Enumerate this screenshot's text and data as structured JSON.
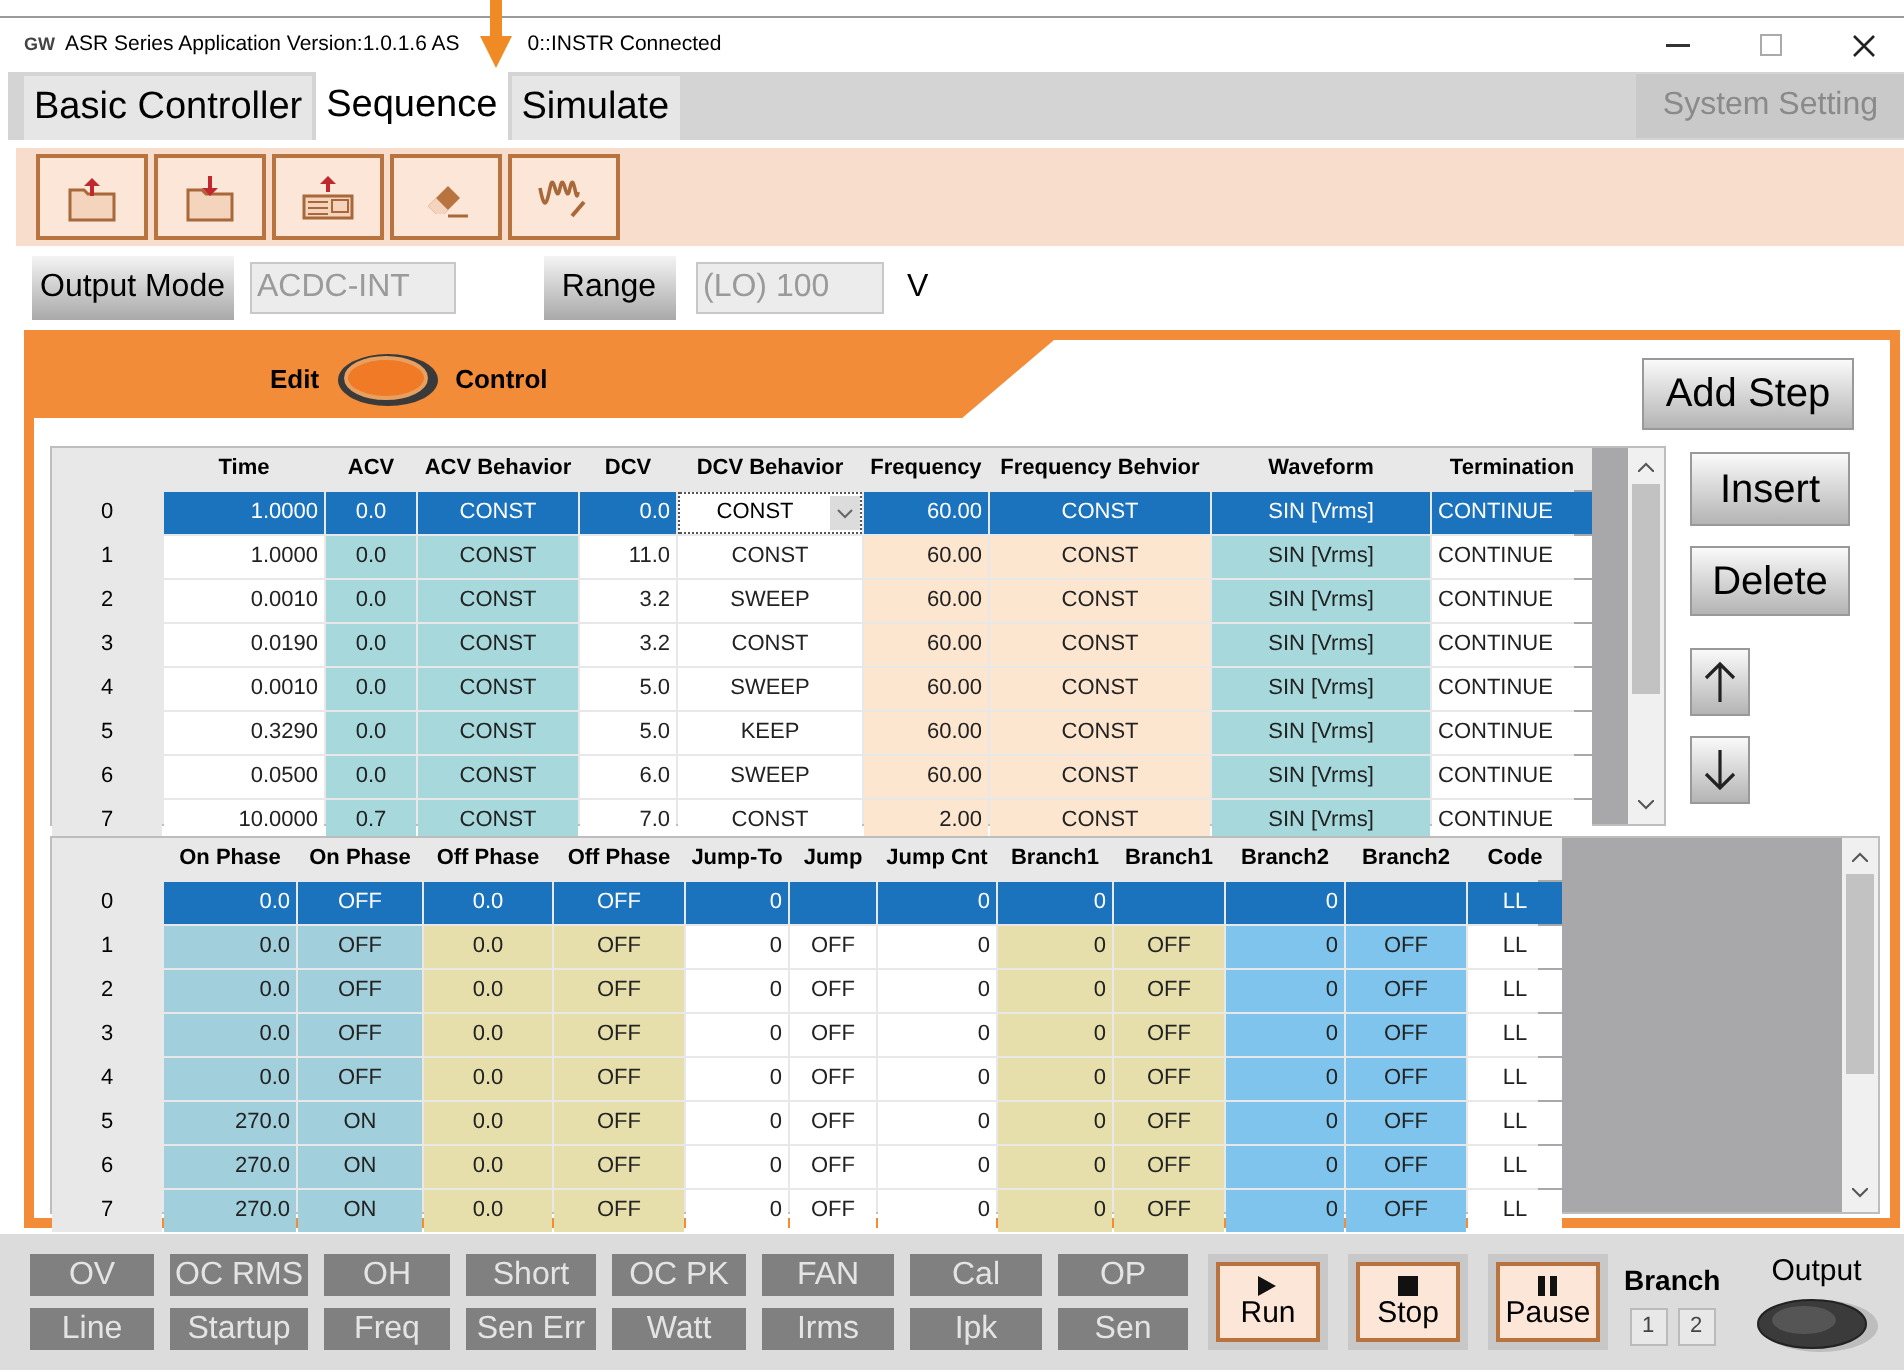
{
  "window": {
    "logo": "GW",
    "title_parts": [
      "ASR Series Application Version:1.0.1.6 AS",
      "0::INSTR Connected"
    ]
  },
  "tabs": [
    {
      "label": "Basic Controller",
      "selected": false
    },
    {
      "label": "Sequence",
      "selected": true
    },
    {
      "label": "Simulate",
      "selected": false
    }
  ],
  "system_setting": "System Setting",
  "output_mode": {
    "label": "Output Mode",
    "value": "ACDC-INT"
  },
  "range": {
    "label": "Range",
    "value": "(LO) 100",
    "unit": "V"
  },
  "mode_switch": {
    "left": "Edit",
    "right": "Control"
  },
  "side_buttons": {
    "add": "Add Step",
    "insert": "Insert",
    "delete": "Delete"
  },
  "step_table": {
    "columns": [
      "Time",
      "ACV",
      "ACV Behavior",
      "DCV",
      "DCV Behavior",
      "Frequency",
      "Frequency Behvior",
      "Waveform",
      "Termination"
    ],
    "rows": [
      {
        "index": "0",
        "selected": true,
        "editing": true,
        "cells": [
          "1.0000",
          "0.0",
          "CONST",
          "0.0",
          "CONST",
          "60.00",
          "CONST",
          "SIN [Vrms]",
          "CONTINUE"
        ]
      },
      {
        "index": "1",
        "selected": false,
        "editing": false,
        "cells": [
          "1.0000",
          "0.0",
          "CONST",
          "11.0",
          "CONST",
          "60.00",
          "CONST",
          "SIN [Vrms]",
          "CONTINUE"
        ]
      },
      {
        "index": "2",
        "selected": false,
        "editing": false,
        "cells": [
          "0.0010",
          "0.0",
          "CONST",
          "3.2",
          "SWEEP",
          "60.00",
          "CONST",
          "SIN [Vrms]",
          "CONTINUE"
        ]
      },
      {
        "index": "3",
        "selected": false,
        "editing": false,
        "cells": [
          "0.0190",
          "0.0",
          "CONST",
          "3.2",
          "CONST",
          "60.00",
          "CONST",
          "SIN [Vrms]",
          "CONTINUE"
        ]
      },
      {
        "index": "4",
        "selected": false,
        "editing": false,
        "cells": [
          "0.0010",
          "0.0",
          "CONST",
          "5.0",
          "SWEEP",
          "60.00",
          "CONST",
          "SIN [Vrms]",
          "CONTINUE"
        ]
      },
      {
        "index": "5",
        "selected": false,
        "editing": false,
        "cells": [
          "0.3290",
          "0.0",
          "CONST",
          "5.0",
          "KEEP",
          "60.00",
          "CONST",
          "SIN [Vrms]",
          "CONTINUE"
        ]
      },
      {
        "index": "6",
        "selected": false,
        "editing": false,
        "cells": [
          "0.0500",
          "0.0",
          "CONST",
          "6.0",
          "SWEEP",
          "60.00",
          "CONST",
          "SIN [Vrms]",
          "CONTINUE"
        ]
      },
      {
        "index": "7",
        "selected": false,
        "editing": false,
        "cells": [
          "10.0000",
          "0.7",
          "CONST",
          "7.0",
          "CONST",
          "2.00",
          "CONST",
          "SIN [Vrms]",
          "CONTINUE"
        ]
      }
    ]
  },
  "phase_table": {
    "columns": [
      "On Phase",
      "On Phase",
      "Off Phase",
      "Off Phase",
      "Jump-To",
      "Jump",
      "Jump Cnt",
      "Branch1",
      "Branch1",
      "Branch2",
      "Branch2",
      "Code"
    ],
    "rows": [
      {
        "index": "0",
        "selected": true,
        "cells": [
          "0.0",
          "OFF",
          "0.0",
          "OFF",
          "0",
          null,
          "0",
          "0",
          null,
          "0",
          null,
          "LL"
        ]
      },
      {
        "index": "1",
        "selected": false,
        "cells": [
          "0.0",
          "OFF",
          "0.0",
          "OFF",
          "0",
          "OFF",
          "0",
          "0",
          "OFF",
          "0",
          "OFF",
          "LL"
        ]
      },
      {
        "index": "2",
        "selected": false,
        "cells": [
          "0.0",
          "OFF",
          "0.0",
          "OFF",
          "0",
          "OFF",
          "0",
          "0",
          "OFF",
          "0",
          "OFF",
          "LL"
        ]
      },
      {
        "index": "3",
        "selected": false,
        "cells": [
          "0.0",
          "OFF",
          "0.0",
          "OFF",
          "0",
          "OFF",
          "0",
          "0",
          "OFF",
          "0",
          "OFF",
          "LL"
        ]
      },
      {
        "index": "4",
        "selected": false,
        "cells": [
          "0.0",
          "OFF",
          "0.0",
          "OFF",
          "0",
          "OFF",
          "0",
          "0",
          "OFF",
          "0",
          "OFF",
          "LL"
        ]
      },
      {
        "index": "5",
        "selected": false,
        "cells": [
          "270.0",
          "ON",
          "0.0",
          "OFF",
          "0",
          "OFF",
          "0",
          "0",
          "OFF",
          "0",
          "OFF",
          "LL"
        ]
      },
      {
        "index": "6",
        "selected": false,
        "cells": [
          "270.0",
          "ON",
          "0.0",
          "OFF",
          "0",
          "OFF",
          "0",
          "0",
          "OFF",
          "0",
          "OFF",
          "LL"
        ]
      },
      {
        "index": "7",
        "selected": false,
        "cells": [
          "270.0",
          "ON",
          "0.0",
          "OFF",
          "0",
          "OFF",
          "0",
          "0",
          "OFF",
          "0",
          "OFF",
          "LL"
        ]
      }
    ]
  },
  "status_indicators": [
    {
      "label": "OV",
      "on": false
    },
    {
      "label": "OC RMS",
      "on": false
    },
    {
      "label": "OH",
      "on": false
    },
    {
      "label": "Short",
      "on": false
    },
    {
      "label": "OC PK",
      "on": false
    },
    {
      "label": "FAN",
      "on": false
    },
    {
      "label": "Cal",
      "on": false
    },
    {
      "label": "OP",
      "on": false
    },
    {
      "label": "Line",
      "on": false
    },
    {
      "label": "Startup",
      "on": false
    },
    {
      "label": "Freq",
      "on": false
    },
    {
      "label": "Sen Err",
      "on": false
    },
    {
      "label": "Watt",
      "on": false
    },
    {
      "label": "Irms",
      "on": false
    },
    {
      "label": "Ipk",
      "on": false
    },
    {
      "label": "Sen",
      "on": false
    }
  ],
  "controls": [
    {
      "kind": "run",
      "label": "Run"
    },
    {
      "kind": "stop",
      "label": "Stop"
    },
    {
      "kind": "pause",
      "label": "Pause"
    }
  ],
  "branch": {
    "label": "Branch",
    "buttons": [
      "1",
      "2"
    ]
  },
  "output": {
    "label": "Output"
  }
}
